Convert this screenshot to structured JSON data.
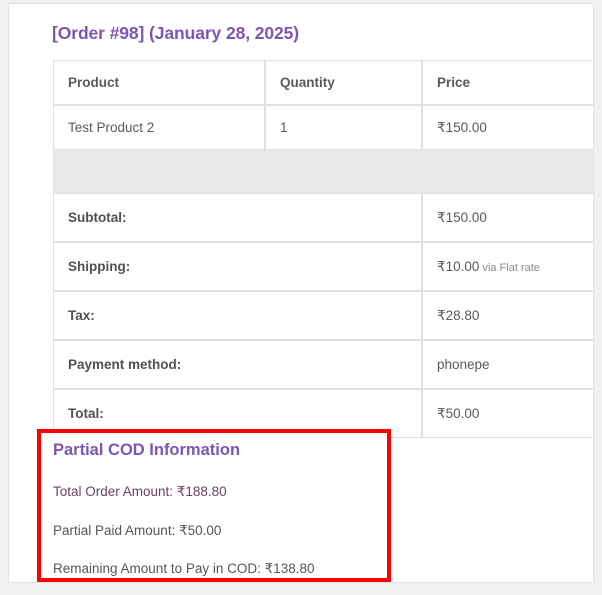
{
  "order": {
    "title": "[Order #98] (January 28, 2025)"
  },
  "items_table": {
    "columns": [
      "Product",
      "Quantity",
      "Price"
    ],
    "rows": [
      {
        "product": "Test Product 2",
        "quantity": "1",
        "price": "₹150.00"
      }
    ],
    "summary": [
      {
        "label": "Subtotal:",
        "value": "₹150.00",
        "note": ""
      },
      {
        "label": "Shipping:",
        "value": "₹10.00",
        "note": "via Flat rate"
      },
      {
        "label": "Tax:",
        "value": "₹28.80",
        "note": ""
      },
      {
        "label": "Payment method:",
        "value": "phonepe",
        "note": ""
      },
      {
        "label": "Total:",
        "value": "₹50.00",
        "note": ""
      }
    ]
  },
  "partial_cod": {
    "heading": "Partial COD Information",
    "total_order_amount": "Total Order Amount: ₹188.80",
    "partial_paid_amount": "Partial Paid Amount: ₹50.00",
    "remaining_amount": "Remaining Amount to Pay in COD: ₹138.80",
    "highlight_color": "#fe0000",
    "heading_color": "#7f54b3"
  }
}
